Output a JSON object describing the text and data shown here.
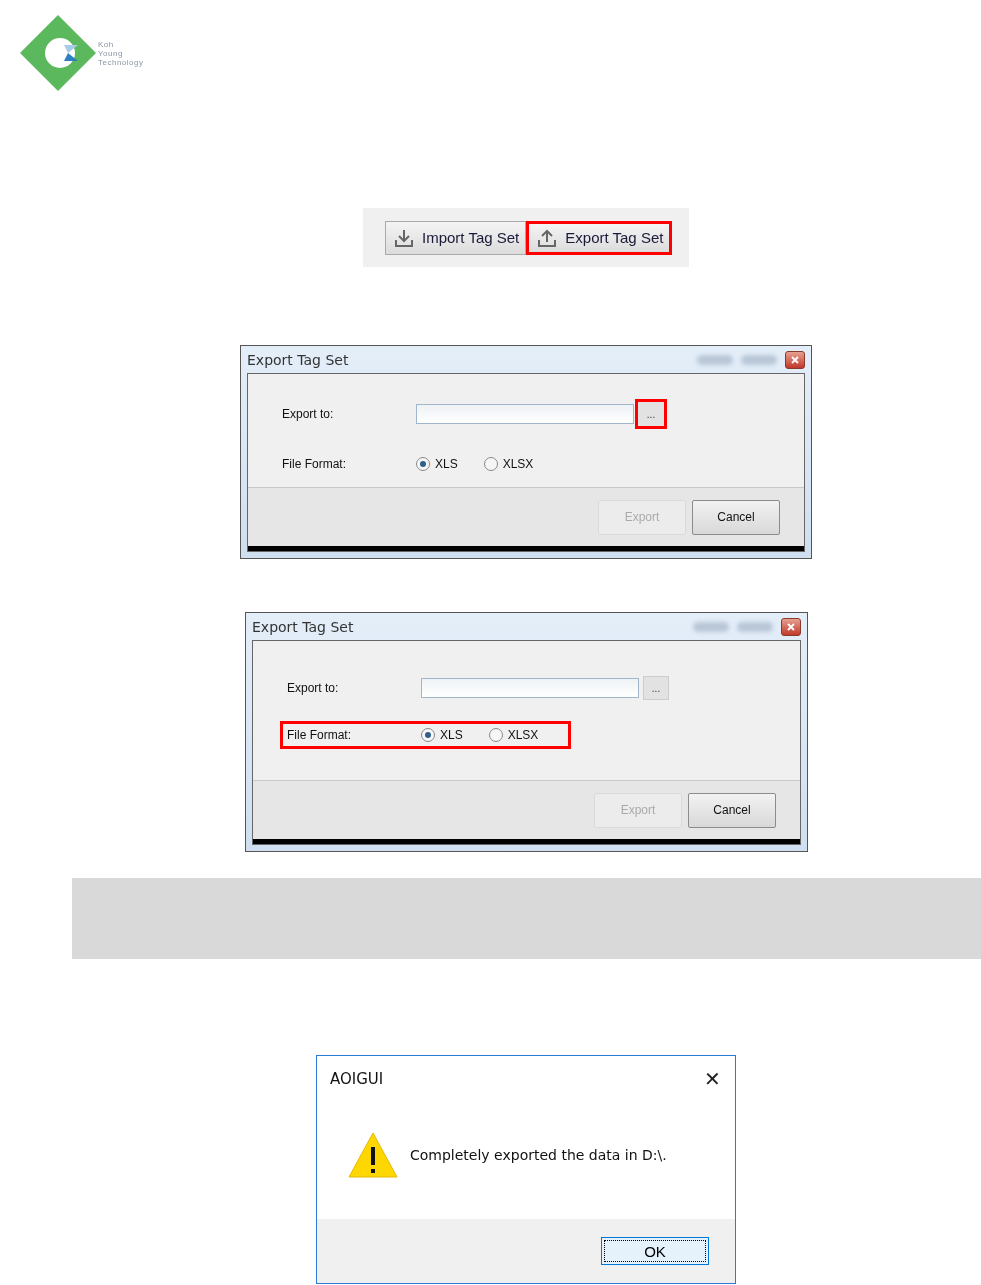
{
  "logo": {
    "lines": [
      "Koh",
      "Young",
      "Technology"
    ]
  },
  "toolbar": {
    "buttons": [
      {
        "kind": "import",
        "label": "Import Tag Set",
        "highlighted": false
      },
      {
        "kind": "export",
        "label": "Export Tag Set",
        "highlighted": true
      }
    ]
  },
  "dialogs": [
    {
      "title": "Export Tag Set",
      "export_to": {
        "label": "Export to:",
        "browse": "...",
        "highlighted": true
      },
      "file_format": {
        "label": "File Format:",
        "highlighted": false,
        "options": [
          {
            "label": "XLS",
            "selected": true
          },
          {
            "label": "XLSX",
            "selected": false
          }
        ]
      },
      "buttons": [
        {
          "label": "Export",
          "disabled": true
        },
        {
          "label": "Cancel",
          "disabled": false
        }
      ]
    },
    {
      "title": "Export Tag Set",
      "export_to": {
        "label": "Export to:",
        "browse": "...",
        "highlighted": false
      },
      "file_format": {
        "label": "File Format:",
        "highlighted": true,
        "options": [
          {
            "label": "XLS",
            "selected": true
          },
          {
            "label": "XLSX",
            "selected": false
          }
        ]
      },
      "buttons": [
        {
          "label": "Export",
          "disabled": true
        },
        {
          "label": "Cancel",
          "disabled": false
        }
      ]
    }
  ],
  "message_box": {
    "title": "AOIGUI",
    "close": "✕",
    "message": "Completely exported the data in D:\\.",
    "ok": "OK"
  }
}
